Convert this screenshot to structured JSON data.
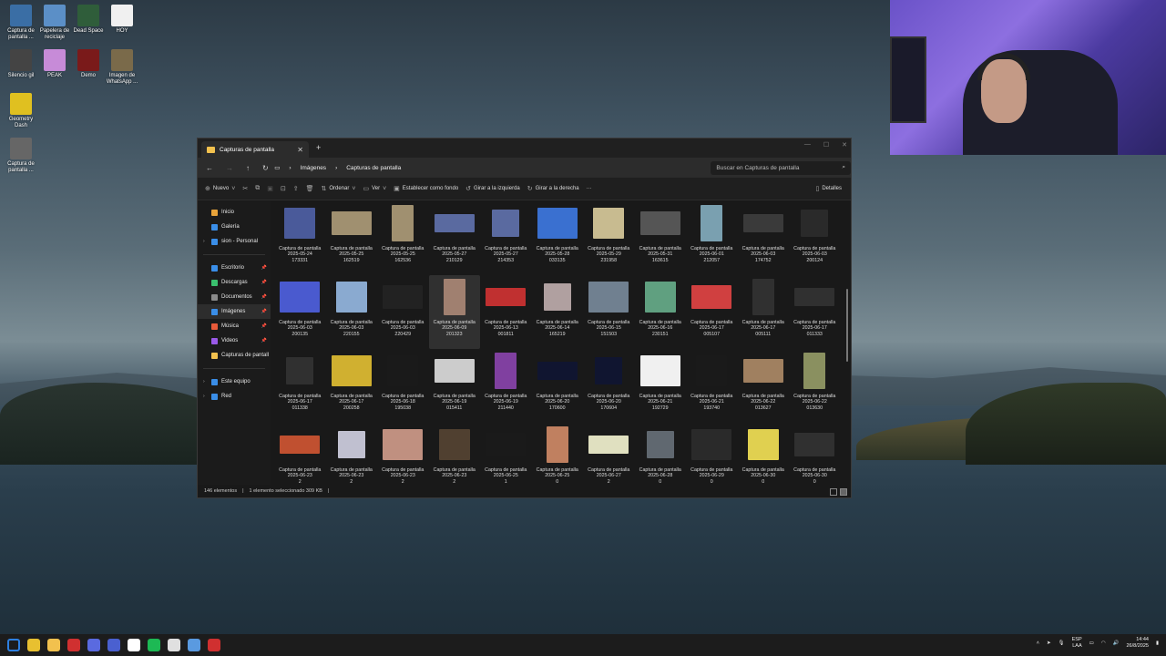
{
  "desktop_icons": [
    {
      "label": "Captura de pantalla ...",
      "color": "#3a6ea5"
    },
    {
      "label": "Papelera de reciclaje",
      "color": "#5b8fc7"
    },
    {
      "label": "Dead Space",
      "color": "#2f5d3a"
    },
    {
      "label": "HOY",
      "color": "#f0f0f0"
    },
    {
      "label": "Silencio gil",
      "color": "#444444"
    },
    {
      "label": "PEAK",
      "color": "#c78bd8"
    },
    {
      "label": "Demo",
      "color": "#7a1a1a"
    },
    {
      "label": "Imagen de WhatsApp ...",
      "color": "#7a6a4a"
    },
    {
      "label": "Geometry Dash",
      "color": "#e0c020"
    },
    {
      "label": "Captura de pantalla ...",
      "color": "#666666"
    }
  ],
  "explorer": {
    "tab_title": "Capturas de pantalla",
    "breadcrumbs": [
      "Imágenes",
      "Capturas de pantalla"
    ],
    "search_placeholder": "Buscar en Capturas de pantalla",
    "toolbar": {
      "new": "Nuevo",
      "sort": "Ordenar",
      "view": "Ver",
      "set_background": "Establecer como fondo",
      "rotate_left": "Girar a la izquierda",
      "rotate_right": "Girar a la derecha",
      "more": "···",
      "details": "Detalles"
    },
    "sidebar": [
      {
        "label": "Inicio",
        "color": "#e8a33a"
      },
      {
        "label": "Galería",
        "color": "#3a8ee8"
      },
      {
        "label": "sion - Personal",
        "color": "#3a8ee8",
        "expand": true
      },
      {
        "label": "Escritorio",
        "color": "#3a8ee8",
        "pinned": true
      },
      {
        "label": "Descargas",
        "color": "#3ac06e",
        "pinned": true
      },
      {
        "label": "Documentos",
        "color": "#8a8a8a",
        "pinned": true
      },
      {
        "label": "Imágenes",
        "color": "#3a8ee8",
        "pinned": true,
        "selected": true
      },
      {
        "label": "Música",
        "color": "#e85a3a",
        "pinned": true
      },
      {
        "label": "Videos",
        "color": "#9a5ae8",
        "pinned": true
      },
      {
        "label": "Capturas de pantall",
        "color": "#f2c14e"
      },
      {
        "label": "Este equipo",
        "color": "#3a8ee8",
        "expand": true
      },
      {
        "label": "Red",
        "color": "#3a8ee8",
        "expand": true
      }
    ],
    "files": [
      {
        "name": "Captura de pantalla\n2025-05-24\n173331",
        "color": "#4a5a9a"
      },
      {
        "name": "Captura de pantalla\n2025-05-25\n162519",
        "color": "#a09070"
      },
      {
        "name": "Captura de pantalla\n2025-05-25\n162536",
        "color": "#a09070"
      },
      {
        "name": "Captura de pantalla\n2025-05-27\n210129",
        "color": "#5a6aa0"
      },
      {
        "name": "Captura de pantalla\n2025-05-27\n214353",
        "color": "#5a6aa0"
      },
      {
        "name": "Captura de pantalla\n2025-05-28\n033135",
        "color": "#3a70d0"
      },
      {
        "name": "Captura de pantalla\n2025-05-29\n231958",
        "color": "#c8bb90"
      },
      {
        "name": "Captura de pantalla\n2025-05-31\n163615",
        "color": "#555555"
      },
      {
        "name": "Captura de pantalla\n2025-06-01\n212057",
        "color": "#7aa0b0"
      },
      {
        "name": "Captura de pantalla\n2025-06-03\n174752",
        "color": "#3a3a3a"
      },
      {
        "name": "Captura de pantalla\n2025-06-03\n200124",
        "color": "#2a2a2a"
      },
      {
        "name": "Captura de pantalla\n2025-06-03\n200135",
        "color": "#4a5acf"
      },
      {
        "name": "Captura de pantalla\n2025-06-03\n220155",
        "color": "#8aaad0"
      },
      {
        "name": "Captura de pantalla\n2025-06-03\n220429",
        "color": "#222222"
      },
      {
        "name": "Captura de pantalla\n2025-06-09\n201323",
        "color": "#a08070",
        "selected": true
      },
      {
        "name": "Captura de pantalla\n2025-06-13\n001811",
        "color": "#c03030"
      },
      {
        "name": "Captura de pantalla\n2025-06-14\n165219",
        "color": "#b0a0a0"
      },
      {
        "name": "Captura de pantalla\n2025-06-15\n151503",
        "color": "#708090"
      },
      {
        "name": "Captura de pantalla\n2025-06-16\n230151",
        "color": "#60a080"
      },
      {
        "name": "Captura de pantalla\n2025-06-17\n005107",
        "color": "#d04040"
      },
      {
        "name": "Captura de pantalla\n2025-06-17\n005111",
        "color": "#303030"
      },
      {
        "name": "Captura de pantalla\n2025-06-17\n011333",
        "color": "#303030"
      },
      {
        "name": "Captura de pantalla\n2025-06-17\n011338",
        "color": "#303030"
      },
      {
        "name": "Captura de pantalla\n2025-06-17\n200258",
        "color": "#d0b030"
      },
      {
        "name": "Captura de pantalla\n2025-06-18\n195038",
        "color": "#1a1a1a"
      },
      {
        "name": "Captura de pantalla\n2025-06-19\n015411",
        "color": "#cccccc"
      },
      {
        "name": "Captura de pantalla\n2025-06-19\n211440",
        "color": "#8040a0"
      },
      {
        "name": "Captura de pantalla\n2025-06-20\n170600",
        "color": "#101530"
      },
      {
        "name": "Captura de pantalla\n2025-06-20\n170604",
        "color": "#101530"
      },
      {
        "name": "Captura de pantalla\n2025-06-21\n192729",
        "color": "#f0f0f0"
      },
      {
        "name": "Captura de pantalla\n2025-06-21\n193740",
        "color": "#1a1a1a"
      },
      {
        "name": "Captura de pantalla\n2025-06-22\n013627",
        "color": "#a08060"
      },
      {
        "name": "Captura de pantalla\n2025-06-22\n013630",
        "color": "#8a9060"
      },
      {
        "name": "Captura de pantalla\n2025-06-23\n2",
        "color": "#c05030"
      },
      {
        "name": "Captura de pantalla\n2025-06-23\n2",
        "color": "#c0c0d0"
      },
      {
        "name": "Captura de pantalla\n2025-06-23\n2",
        "color": "#c09080"
      },
      {
        "name": "Captura de pantalla\n2025-06-23\n2",
        "color": "#504030"
      },
      {
        "name": "Captura de pantalla\n2025-06-25\n1",
        "color": "#1a1a1a"
      },
      {
        "name": "Captura de pantalla\n2025-06-25\n0",
        "color": "#c08060"
      },
      {
        "name": "Captura de pantalla\n2025-06-27\n2",
        "color": "#e0e0c0"
      },
      {
        "name": "Captura de pantalla\n2025-06-28\n0",
        "color": "#606870"
      },
      {
        "name": "Captura de pantalla\n2025-06-29\n0",
        "color": "#2a2a2a"
      },
      {
        "name": "Captura de pantalla\n2025-06-30\n0",
        "color": "#e0d050"
      },
      {
        "name": "Captura de pantalla\n2025-06-30\n0",
        "color": "#303030"
      }
    ],
    "status": {
      "count": "146 elementos",
      "selection": "1 elemento seleccionado  309 KB"
    }
  },
  "taskbar": {
    "apps": [
      "#2d7fe0",
      "#e8c030",
      "#f2c14e",
      "#d03030",
      "#5a6ae0",
      "#4a60d0",
      "#ffffff",
      "#1db954",
      "#e0e0e0",
      "#5a9ae0",
      "#d03030"
    ],
    "lang_top": "ESP",
    "lang_bottom": "LAA",
    "time": "14:44",
    "date": "26/8/2025"
  }
}
